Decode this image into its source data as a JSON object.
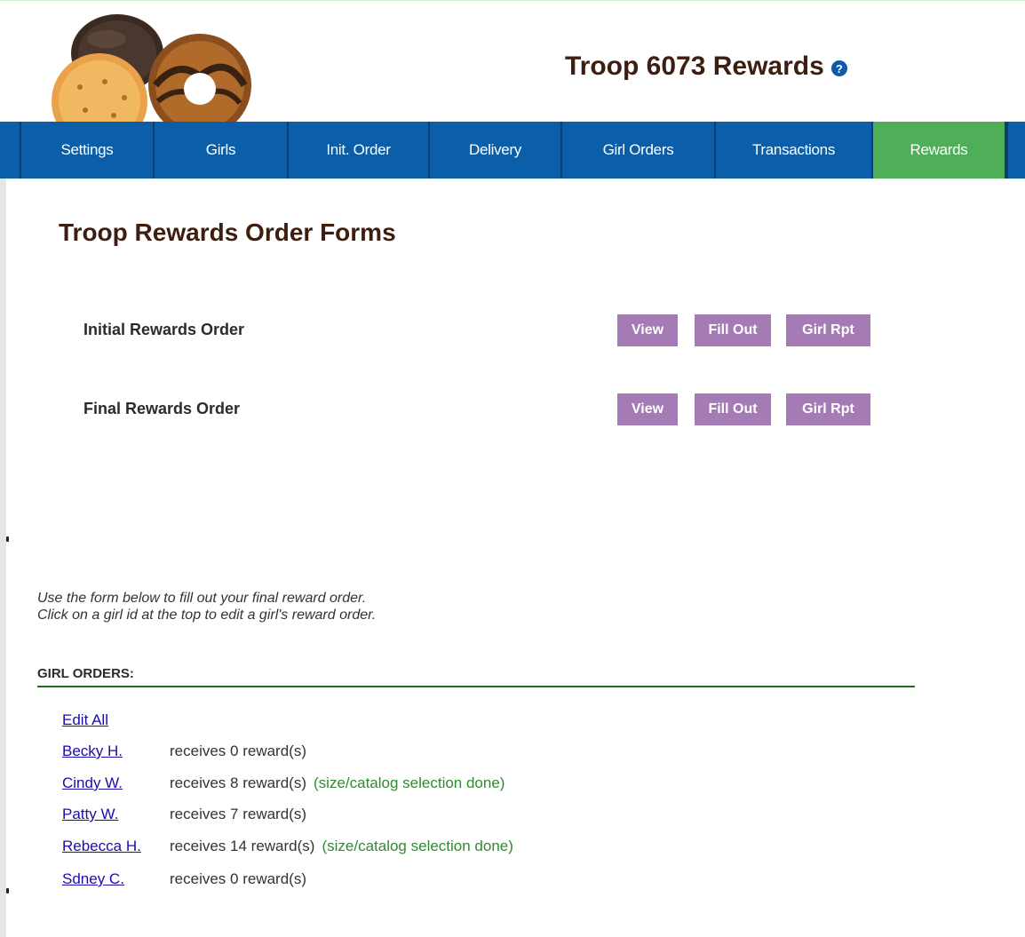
{
  "header": {
    "title": "Troop 6073 Rewards"
  },
  "nav": {
    "items": [
      {
        "label": "Settings"
      },
      {
        "label": "Girls"
      },
      {
        "label": "Init. Order"
      },
      {
        "label": "Delivery"
      },
      {
        "label": "Girl Orders"
      },
      {
        "label": "Transactions"
      },
      {
        "label": "Rewards"
      }
    ],
    "active": "Rewards"
  },
  "main": {
    "title": "Troop Rewards Order Forms",
    "forms": [
      {
        "label": "Initial Rewards Order",
        "view": "View",
        "fill_out": "Fill Out",
        "girl_rpt": "Girl Rpt"
      },
      {
        "label": "Final Rewards Order",
        "view": "View",
        "fill_out": "Fill Out",
        "girl_rpt": "Girl Rpt"
      }
    ],
    "instructions": [
      "Use the form below to fill out your final reward order.",
      "Click on a girl id at the top to edit a girl's reward order."
    ],
    "orders_heading": "GIRL ORDERS:",
    "edit_all": "Edit All",
    "girls": [
      {
        "name": "Becky H.",
        "text": "receives 0 reward(s)",
        "status": ""
      },
      {
        "name": "Cindy W.",
        "text": "receives 8 reward(s)",
        "status": "(size/catalog selection done)"
      },
      {
        "name": "Patty W.",
        "text": "receives 7 reward(s)",
        "status": ""
      },
      {
        "name": "Rebecca H.",
        "text": "receives 14 reward(s)",
        "status": "(size/catalog selection done)"
      },
      {
        "name": "Sdney C.",
        "text": "receives 0 reward(s)",
        "status": ""
      }
    ]
  },
  "colors": {
    "nav_bg": "#0b5ea8",
    "nav_active": "#4fae58",
    "button_purple": "#a57bb5",
    "heading_brown": "#3d1f12",
    "rule_green": "#1d6b1d",
    "status_green": "#2e8b2e",
    "link_blue": "#1a0dab"
  },
  "icons": {
    "help": "question-circle-icon",
    "logo": "cookies-logo"
  }
}
